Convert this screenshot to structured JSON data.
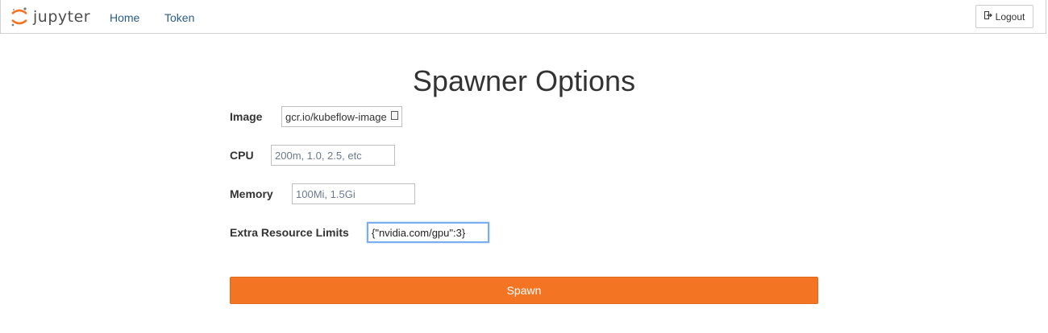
{
  "header": {
    "logo_text": "jupyter",
    "nav": {
      "home_label": "Home",
      "token_label": "Token"
    },
    "logout_label": "Logout"
  },
  "main": {
    "title": "Spawner Options",
    "fields": {
      "image": {
        "label": "Image",
        "value": "gcr.io/kubeflow-image"
      },
      "cpu": {
        "label": "CPU",
        "placeholder": "200m, 1.0, 2.5, etc"
      },
      "memory": {
        "label": "Memory",
        "placeholder": "100Mi, 1.5Gi"
      },
      "extra_resource_limits": {
        "label": "Extra Resource Limits",
        "value": "{\"nvidia.com/gpu\":3}"
      }
    },
    "spawn_label": "Spawn"
  },
  "colors": {
    "accent": "#f37524",
    "link": "#2a5d8c",
    "focus": "#7aaef0"
  }
}
